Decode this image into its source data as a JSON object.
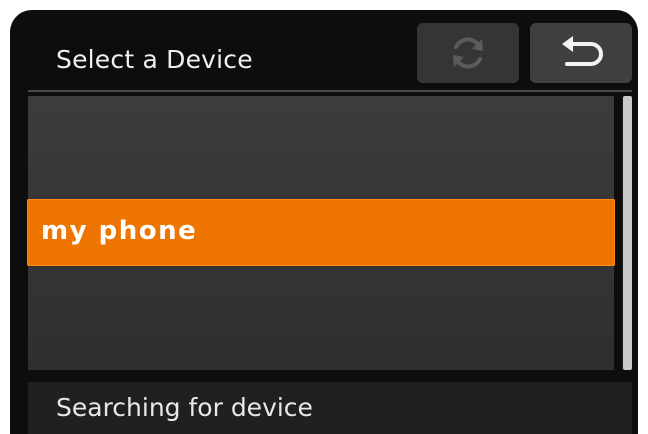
{
  "header": {
    "title": "Select a Device",
    "refresh_icon": "refresh-icon",
    "back_icon": "return-arrow-icon"
  },
  "device_list": {
    "items": [
      {
        "label": "my phone",
        "selected": true
      }
    ]
  },
  "status": {
    "text": "Searching for device"
  },
  "colors": {
    "accent": "#ee7600",
    "background": "#0d0d0d",
    "list_bg": "#363636"
  }
}
